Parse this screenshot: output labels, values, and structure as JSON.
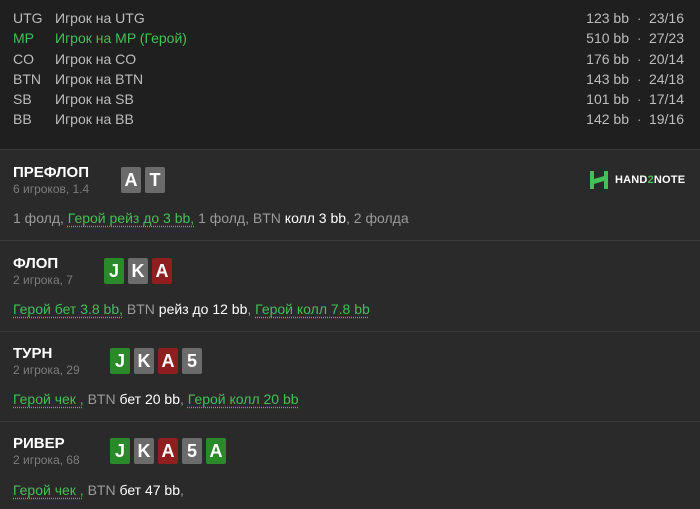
{
  "players": [
    {
      "pos": "UTG",
      "name": "Игрок на UTG",
      "stack": "123 bb",
      "stat": "23/16",
      "hero": false
    },
    {
      "pos": "MP",
      "name": "Игрок на MP (Герой)",
      "stack": "510 bb",
      "stat": "27/23",
      "hero": true
    },
    {
      "pos": "CO",
      "name": "Игрок на CO",
      "stack": "176 bb",
      "stat": "20/14",
      "hero": false
    },
    {
      "pos": "BTN",
      "name": "Игрок на BTN",
      "stack": "143 bb",
      "stat": "24/18",
      "hero": false
    },
    {
      "pos": "SB",
      "name": "Игрок на SB",
      "stack": "101 bb",
      "stat": "17/14",
      "hero": false
    },
    {
      "pos": "BB",
      "name": "Игрок на BB",
      "stack": "142 bb",
      "stat": "19/16",
      "hero": false
    }
  ],
  "dot": "·",
  "logo": {
    "brand_left": "HAND",
    "brand_mid": "2",
    "brand_right": "NOTE"
  },
  "colors": {
    "hero_green": "#43c057",
    "card_green": "#2a8a2a",
    "card_red": "#8f1e1e",
    "card_grey": "#6b6b6b"
  },
  "streets": [
    {
      "title": "ПРЕФЛОП",
      "sub": "6 игроков, 1.4",
      "cards": [
        {
          "rank": "A",
          "color": "grey"
        },
        {
          "rank": "T",
          "color": "grey"
        }
      ],
      "actions": [
        {
          "t": "1 фолд, ",
          "s": "n"
        },
        {
          "t": "Герой рейз до 3 bb,",
          "s": "h"
        },
        {
          "t": " 1 фолд, BTN ",
          "s": "n"
        },
        {
          "t": "колл 3 bb",
          "s": "w"
        },
        {
          "t": ", 2 фолда",
          "s": "n"
        }
      ]
    },
    {
      "title": "ФЛОП",
      "sub": "2 игрока, 7",
      "cards": [
        {
          "rank": "J",
          "color": "green"
        },
        {
          "rank": "K",
          "color": "grey"
        },
        {
          "rank": "A",
          "color": "red"
        }
      ],
      "actions": [
        {
          "t": "Герой бет 3.8 bb,",
          "s": "h"
        },
        {
          "t": " BTN ",
          "s": "n"
        },
        {
          "t": "рейз до 12 bb",
          "s": "w"
        },
        {
          "t": ", ",
          "s": "n"
        },
        {
          "t": "Герой колл 7.8 bb",
          "s": "h"
        }
      ]
    },
    {
      "title": "ТУРН",
      "sub": "2 игрока, 29",
      "cards": [
        {
          "rank": "J",
          "color": "green"
        },
        {
          "rank": "K",
          "color": "grey"
        },
        {
          "rank": "A",
          "color": "red"
        },
        {
          "rank": "5",
          "color": "grey"
        }
      ],
      "actions": [
        {
          "t": "Герой чек ,",
          "s": "h"
        },
        {
          "t": " BTN ",
          "s": "n"
        },
        {
          "t": "бет 20 bb",
          "s": "w"
        },
        {
          "t": ", ",
          "s": "n"
        },
        {
          "t": "Герой колл 20 bb",
          "s": "h"
        }
      ]
    },
    {
      "title": "РИВЕР",
      "sub": "2 игрока, 68",
      "cards": [
        {
          "rank": "J",
          "color": "green"
        },
        {
          "rank": "K",
          "color": "grey"
        },
        {
          "rank": "A",
          "color": "red"
        },
        {
          "rank": "5",
          "color": "grey"
        },
        {
          "rank": "A",
          "color": "green"
        }
      ],
      "actions": [
        {
          "t": "Герой чек ,",
          "s": "h"
        },
        {
          "t": " BTN ",
          "s": "n"
        },
        {
          "t": "бет 47 bb",
          "s": "w"
        },
        {
          "t": ",",
          "s": "n"
        }
      ]
    }
  ]
}
